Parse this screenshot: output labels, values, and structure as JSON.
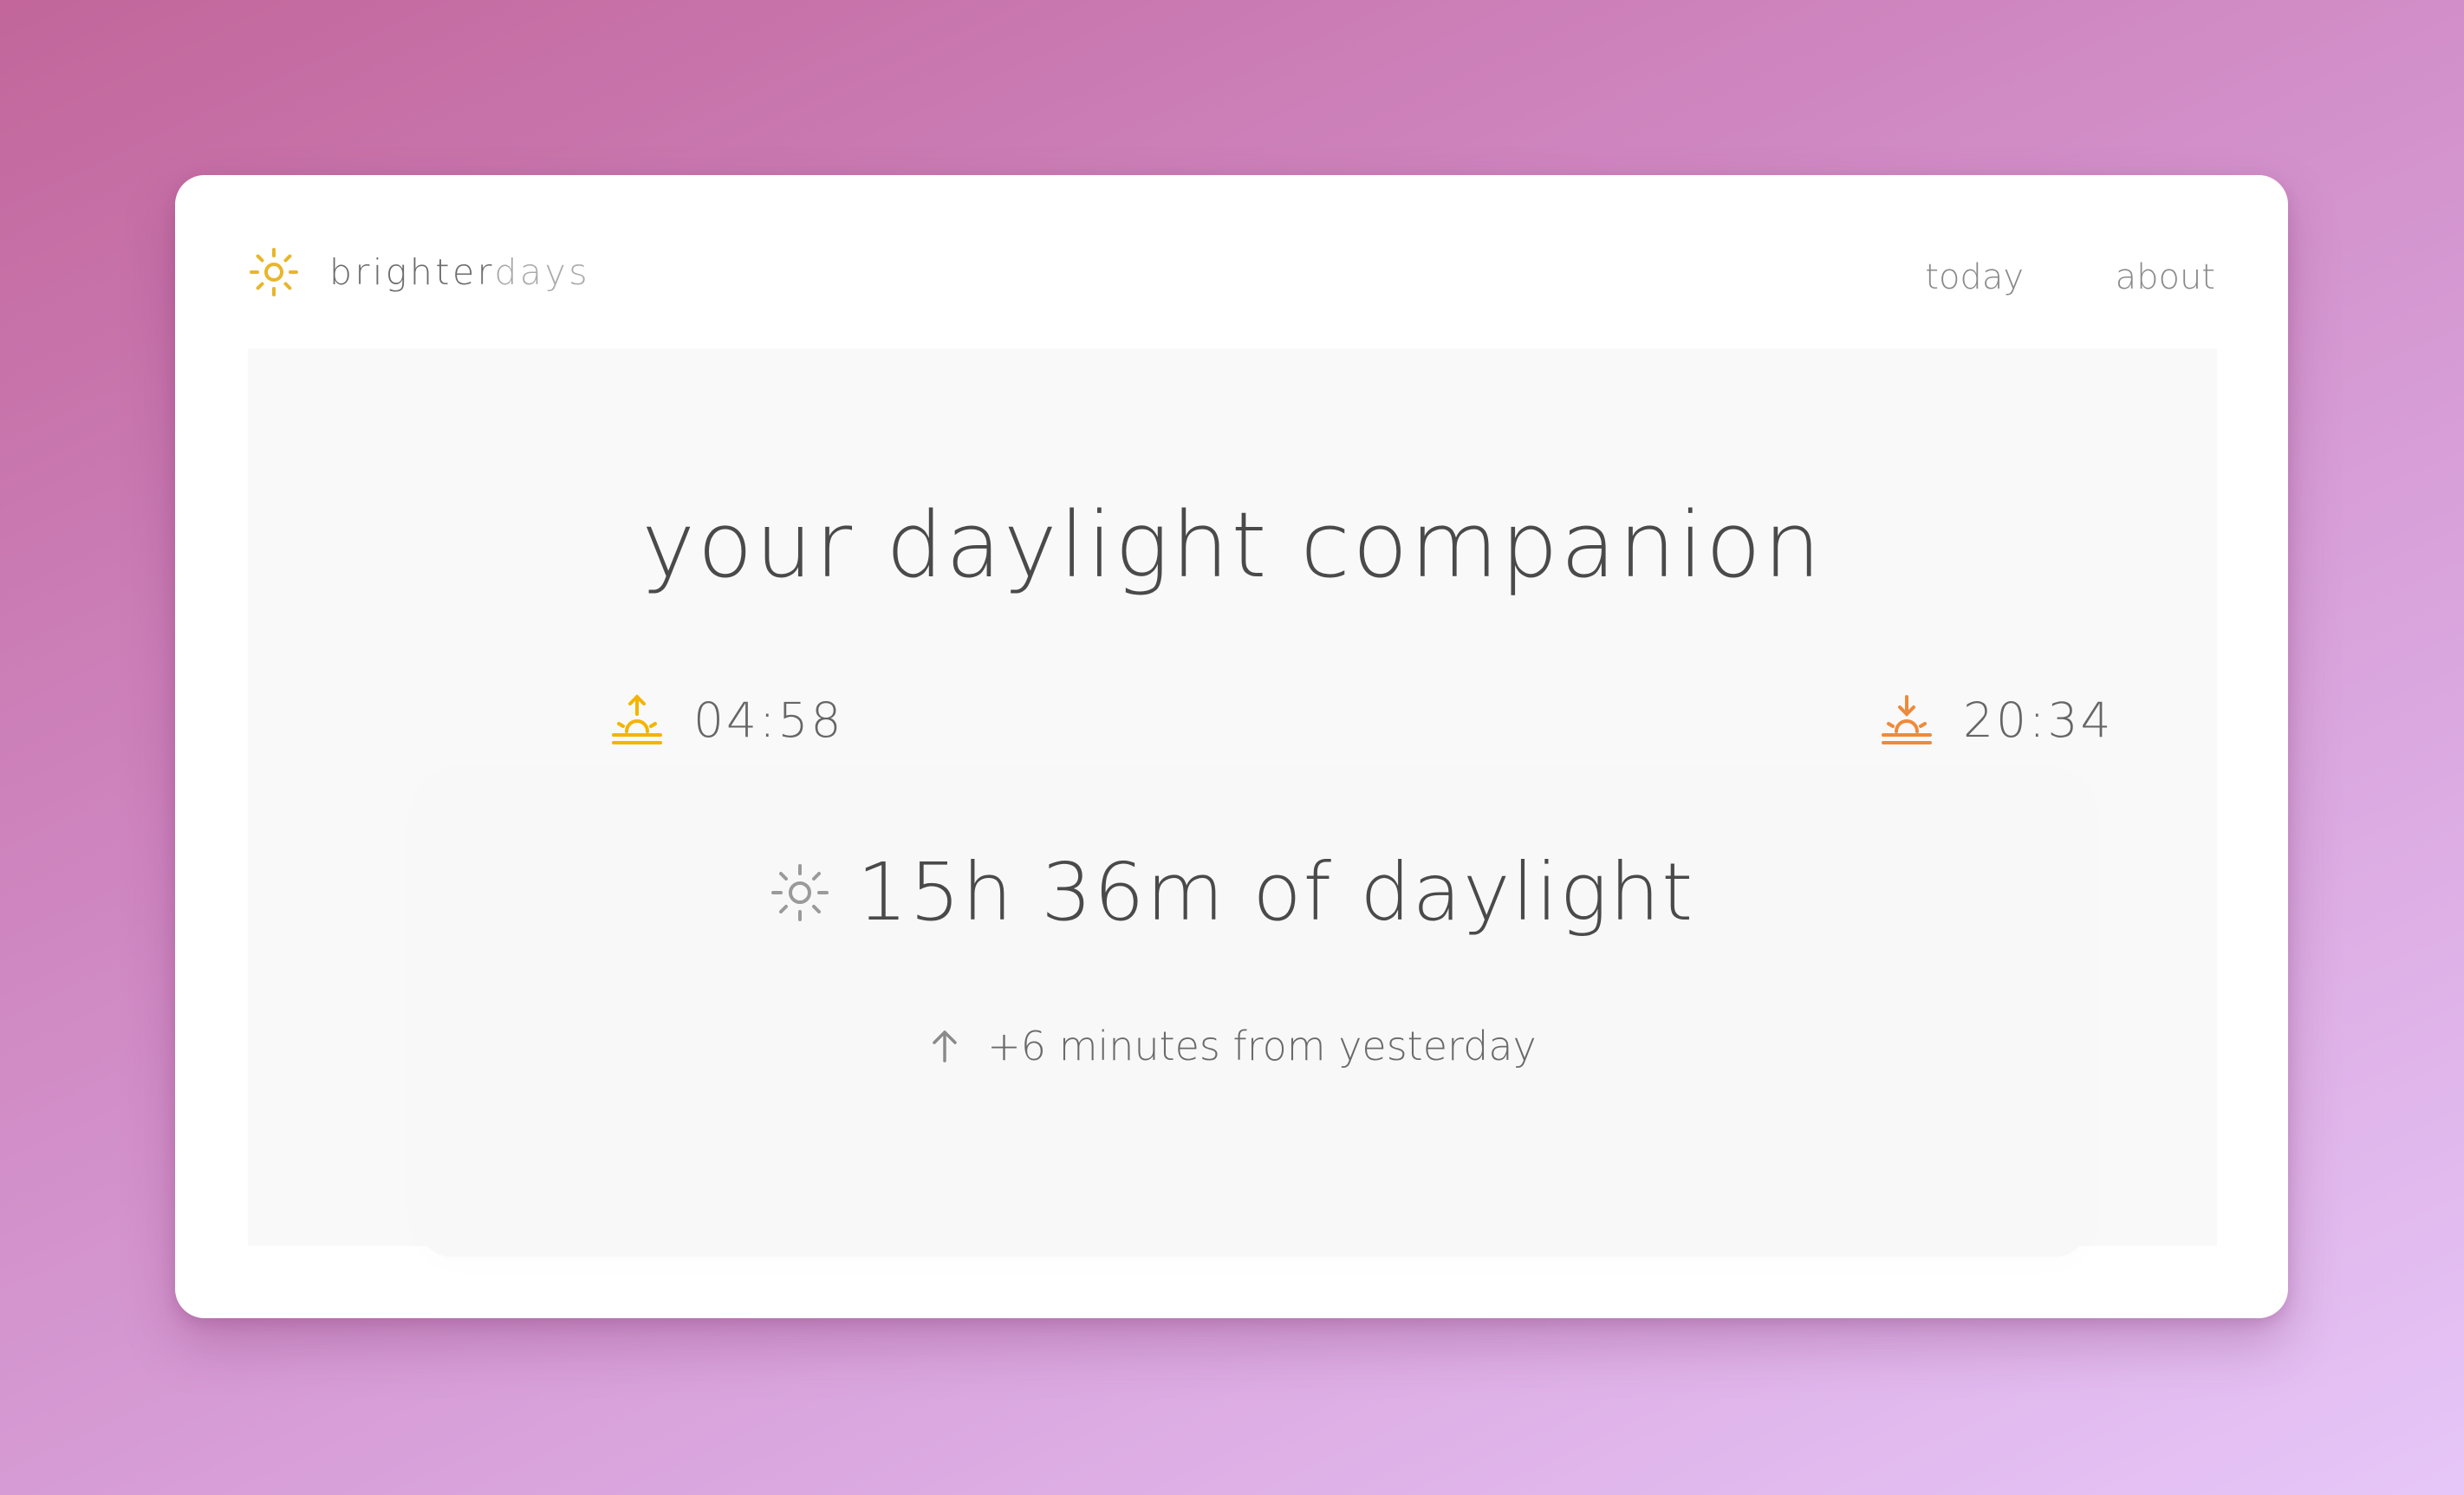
{
  "app": {
    "brand_primary": "brighter",
    "brand_secondary": "days",
    "brand_icon": "sun-icon"
  },
  "nav": {
    "links": [
      {
        "label": "today"
      },
      {
        "label": "about"
      }
    ]
  },
  "hero": {
    "headline": "your daylight companion"
  },
  "daylight": {
    "sunrise": {
      "time": "04:58",
      "icon": "sunrise-icon",
      "color": "#f4b400"
    },
    "sunset": {
      "time": "20:34",
      "icon": "sunset-icon",
      "color": "#ef8a3b"
    },
    "duration_text": "15h 36m of daylight",
    "duration_icon": "sun-icon",
    "change_text": "+6 minutes from yesterday",
    "change_icon": "arrow-up-icon"
  },
  "colors": {
    "brand_sun": "#e8b62a",
    "background_start": "#c2669b",
    "background_end": "#e6c6f8"
  }
}
